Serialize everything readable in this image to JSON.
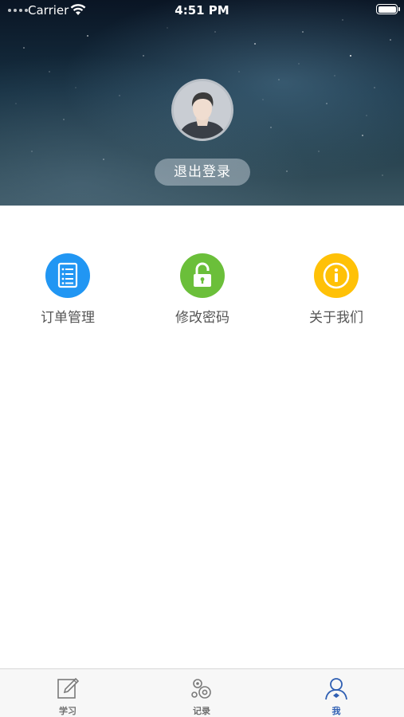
{
  "status_bar": {
    "carrier": "Carrier",
    "time": "4:51 PM"
  },
  "profile": {
    "avatar_icon": "user-avatar-icon",
    "logout_label": "退出登录"
  },
  "menu": {
    "items": [
      {
        "label": "订单管理",
        "icon": "list-icon",
        "color": "#2196F3"
      },
      {
        "label": "修改密码",
        "icon": "unlock-icon",
        "color": "#6BBF3A"
      },
      {
        "label": "关于我们",
        "icon": "info-icon",
        "color": "#FFC107"
      }
    ]
  },
  "tabbar": {
    "items": [
      {
        "label": "学习",
        "icon": "edit-icon",
        "active": false
      },
      {
        "label": "记录",
        "icon": "gears-icon",
        "active": false
      },
      {
        "label": "我",
        "icon": "person-icon",
        "active": true
      }
    ],
    "active_color": "#2F5FB3",
    "inactive_color": "#6F6F6F"
  }
}
